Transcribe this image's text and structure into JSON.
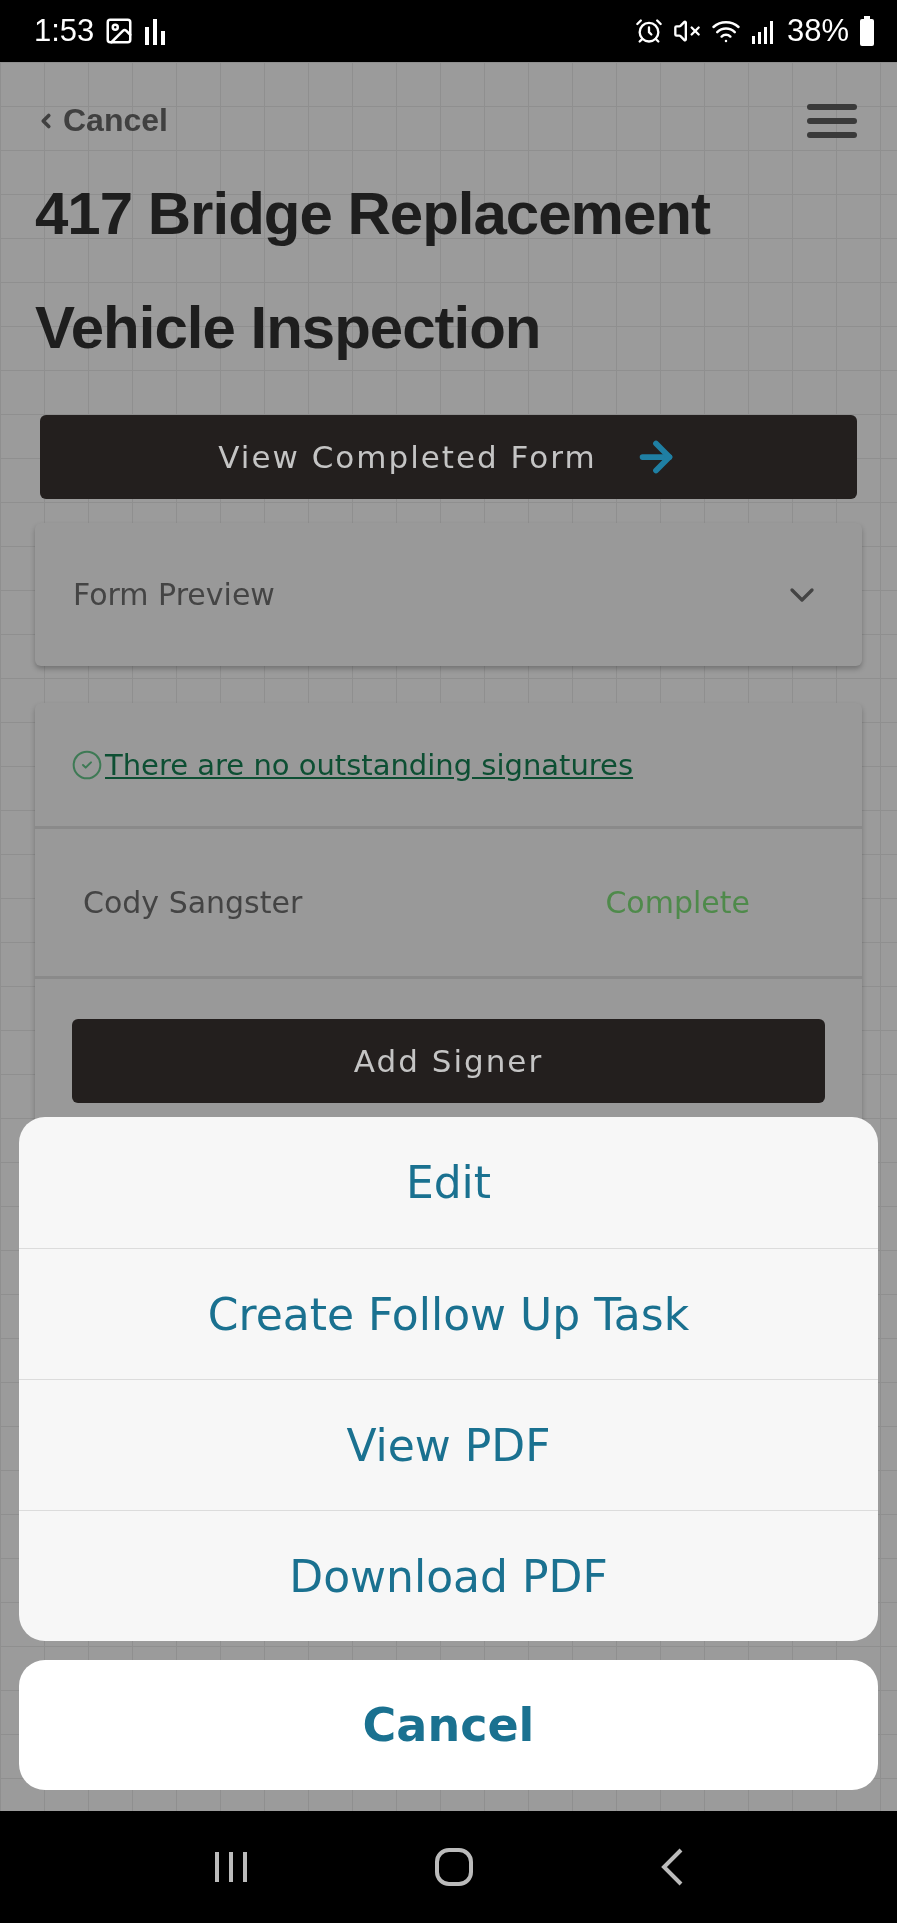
{
  "status_bar": {
    "time": "1:53",
    "battery": "38%"
  },
  "header": {
    "back": "Cancel",
    "title_lines": [
      "417 Bridge Replacement",
      "Vehicle Inspection"
    ]
  },
  "view_button": "View Completed Form",
  "form_preview": {
    "label": "Form Preview",
    "expanded": false
  },
  "signatures": {
    "notice": "There are no outstanding signatures",
    "signers": [
      {
        "name": "Cody Sangster",
        "status": "Complete"
      }
    ],
    "add_button": "Add Signer"
  },
  "action_sheet": {
    "actions": [
      "Edit",
      "Create Follow Up Task",
      "View PDF",
      "Download PDF"
    ],
    "cancel": "Cancel"
  }
}
